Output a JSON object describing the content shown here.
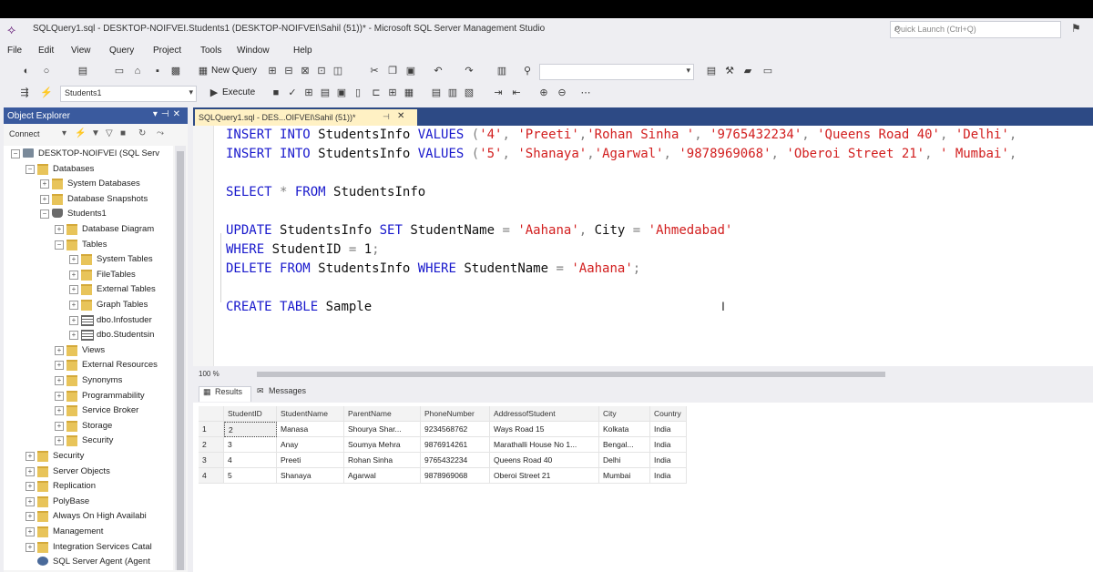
{
  "window": {
    "title": "SQLQuery1.sql - DESKTOP-NOIFVEI.Students1 (DESKTOP-NOIFVEI\\Sahil (51))* - Microsoft SQL Server Management Studio",
    "quick_launch_placeholder": "Quick Launch (Ctrl+Q)"
  },
  "menu": [
    "File",
    "Edit",
    "View",
    "Query",
    "Project",
    "Tools",
    "Window",
    "Help"
  ],
  "toolbar": {
    "new_query_label": "New Query",
    "database_selector": "Students1",
    "execute_label": "Execute"
  },
  "object_explorer": {
    "title": "Object Explorer",
    "connect_label": "Connect",
    "tree": [
      {
        "label": "DESKTOP-NOIFVEI (SQL Serv",
        "icon": "server"
      },
      {
        "label": "Databases",
        "icon": "folder"
      },
      {
        "label": "System Databases",
        "icon": "folder"
      },
      {
        "label": "Database Snapshots",
        "icon": "folder"
      },
      {
        "label": "Students1",
        "icon": "database"
      },
      {
        "label": "Database Diagram",
        "icon": "folder"
      },
      {
        "label": "Tables",
        "icon": "folder"
      },
      {
        "label": "System Tables",
        "icon": "folder"
      },
      {
        "label": "FileTables",
        "icon": "folder"
      },
      {
        "label": "External Tables",
        "icon": "folder"
      },
      {
        "label": "Graph Tables",
        "icon": "folder"
      },
      {
        "label": "dbo.Infostuder",
        "icon": "table"
      },
      {
        "label": "dbo.Studentsin",
        "icon": "table"
      },
      {
        "label": "Views",
        "icon": "folder"
      },
      {
        "label": "External Resources",
        "icon": "folder"
      },
      {
        "label": "Synonyms",
        "icon": "folder"
      },
      {
        "label": "Programmability",
        "icon": "folder"
      },
      {
        "label": "Service Broker",
        "icon": "folder"
      },
      {
        "label": "Storage",
        "icon": "folder"
      },
      {
        "label": "Security",
        "icon": "folder"
      },
      {
        "label": "Security",
        "icon": "folder"
      },
      {
        "label": "Server Objects",
        "icon": "folder"
      },
      {
        "label": "Replication",
        "icon": "folder"
      },
      {
        "label": "PolyBase",
        "icon": "folder"
      },
      {
        "label": "Always On High Availabi",
        "icon": "folder"
      },
      {
        "label": "Management",
        "icon": "folder"
      },
      {
        "label": "Integration Services Catal",
        "icon": "folder"
      },
      {
        "label": "SQL Server Agent (Agent",
        "icon": "agent"
      }
    ]
  },
  "editor": {
    "tab_label": "SQLQuery1.sql - DES...OIFVEI\\Sahil (51))*",
    "lines": [
      [
        [
          "kw",
          "INSERT "
        ],
        [
          "kw",
          "INTO "
        ],
        [
          "id",
          "StudentsInfo "
        ],
        [
          "kw",
          "VALUES "
        ],
        [
          "op",
          "("
        ],
        [
          "str",
          "'4'"
        ],
        [
          "op",
          ", "
        ],
        [
          "str",
          "'Preeti'"
        ],
        [
          "op",
          ","
        ],
        [
          "str",
          "'Rohan Sinha '"
        ],
        [
          "op",
          ", "
        ],
        [
          "str",
          "'9765432234'"
        ],
        [
          "op",
          ", "
        ],
        [
          "str",
          "'Queens Road 40'"
        ],
        [
          "op",
          ", "
        ],
        [
          "str",
          "'Delhi'"
        ],
        [
          "op",
          ","
        ]
      ],
      [
        [
          "kw",
          "INSERT "
        ],
        [
          "kw",
          "INTO "
        ],
        [
          "id",
          "StudentsInfo "
        ],
        [
          "kw",
          "VALUES "
        ],
        [
          "op",
          "("
        ],
        [
          "str",
          "'5'"
        ],
        [
          "op",
          ", "
        ],
        [
          "str",
          "'Shanaya'"
        ],
        [
          "op",
          ","
        ],
        [
          "str",
          "'Agarwal'"
        ],
        [
          "op",
          ", "
        ],
        [
          "str",
          "'9878969068'"
        ],
        [
          "op",
          ", "
        ],
        [
          "str",
          "'Oberoi Street 21'"
        ],
        [
          "op",
          ", "
        ],
        [
          "str",
          "' Mumbai'"
        ],
        [
          "op",
          ","
        ]
      ],
      [],
      [
        [
          "kw",
          "SELECT "
        ],
        [
          "op",
          "* "
        ],
        [
          "kw",
          "FROM "
        ],
        [
          "id",
          "StudentsInfo"
        ]
      ],
      [],
      [
        [
          "kw",
          "UPDATE "
        ],
        [
          "id",
          "StudentsInfo "
        ],
        [
          "kw",
          "SET "
        ],
        [
          "id",
          "StudentName "
        ],
        [
          "op",
          "= "
        ],
        [
          "str",
          "'Aahana'"
        ],
        [
          "op",
          ", "
        ],
        [
          "id",
          "City "
        ],
        [
          "op",
          "= "
        ],
        [
          "str",
          "'Ahmedabad'"
        ]
      ],
      [
        [
          "kw",
          "WHERE "
        ],
        [
          "id",
          "StudentID "
        ],
        [
          "op",
          "= "
        ],
        [
          "id",
          "1"
        ],
        [
          "op",
          ";"
        ]
      ],
      [
        [
          "kw",
          "DELETE "
        ],
        [
          "kw",
          "FROM "
        ],
        [
          "id",
          "StudentsInfo "
        ],
        [
          "kw",
          "WHERE "
        ],
        [
          "id",
          "StudentName "
        ],
        [
          "op",
          "= "
        ],
        [
          "str",
          "'Aahana'"
        ],
        [
          "op",
          ";"
        ]
      ],
      [],
      [
        [
          "kw",
          "CREATE "
        ],
        [
          "kw",
          "TABLE "
        ],
        [
          "id",
          "Sample"
        ]
      ]
    ],
    "zoom": "100 %"
  },
  "results": {
    "tabs": [
      "Results",
      "Messages"
    ],
    "columns": [
      "StudentID",
      "StudentName",
      "ParentName",
      "PhoneNumber",
      "AddressofStudent",
      "City",
      "Country"
    ],
    "rows": [
      [
        "1",
        "2",
        "Manasa",
        "Shourya Shar...",
        "9234568762",
        "Ways Road 15",
        "Kolkata",
        "India"
      ],
      [
        "2",
        "3",
        "Anay",
        "Soumya Mehra",
        "9876914261",
        "Marathalli House No 1...",
        "Bengal...",
        "India"
      ],
      [
        "3",
        "4",
        "Preeti",
        "Rohan Sinha",
        "9765432234",
        "Queens Road 40",
        "Delhi",
        "India"
      ],
      [
        "4",
        "5",
        "Shanaya",
        "Agarwal",
        "9878969068",
        "Oberoi Street 21",
        "Mumbai",
        "India"
      ]
    ]
  },
  "colors": {
    "keyword": "#1818cc",
    "string": "#d21e1e",
    "oe_header": "#3a5a9e",
    "tab_strip": "#2d4a85",
    "active_tab": "#fff1c4"
  }
}
